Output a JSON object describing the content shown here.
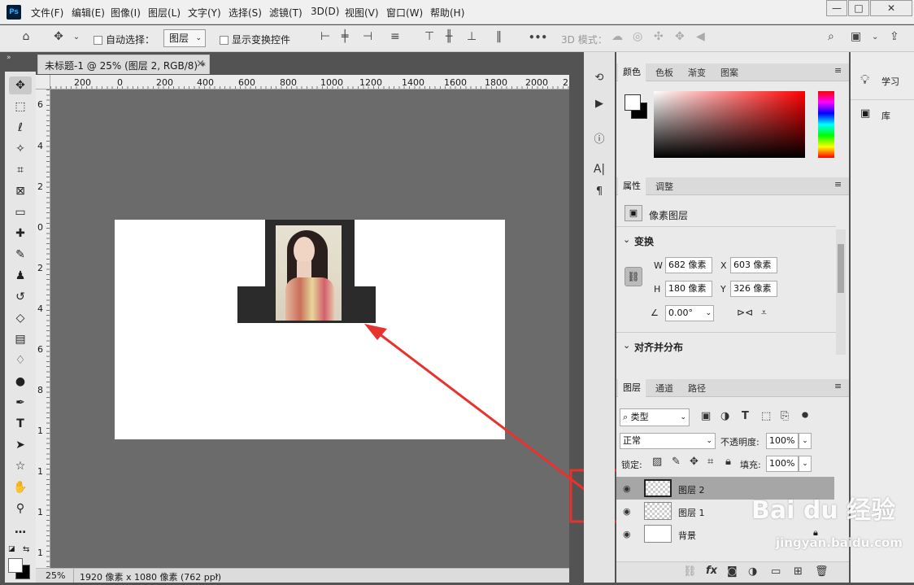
{
  "app": {
    "logo": "Ps",
    "menus": [
      "文件(F)",
      "编辑(E)",
      "图像(I)",
      "图层(L)",
      "文字(Y)",
      "选择(S)",
      "滤镜(T)",
      "3D(D)",
      "视图(V)",
      "窗口(W)",
      "帮助(H)"
    ],
    "window_buttons": {
      "minimize": "—",
      "maximize": "□",
      "close": "✕"
    }
  },
  "options": {
    "auto_select_label": "自动选择：",
    "auto_select_target": "图层",
    "show_transform_label": "显示变换控件",
    "more_label": "•••",
    "mode_3d_label": "3D 模式："
  },
  "document": {
    "tab_title": "未标题-1 @ 25% (图层 2, RGB/8) *",
    "tab_close": "×",
    "zoom": "25%",
    "size_info": "1920 像素 x 1080 像素 (762 ppi)",
    "status_arrow": "›"
  },
  "rulers": {
    "h_ticks": [
      "200",
      "0",
      "200",
      "400",
      "600",
      "800",
      "1000",
      "1200",
      "1400",
      "1600",
      "1800",
      "2000",
      "2"
    ],
    "v_ticks": [
      "6",
      "4",
      "2",
      "0",
      "2",
      "4",
      "6",
      "8",
      "1",
      "1",
      "1",
      "1"
    ]
  },
  "color_panel": {
    "tabs": [
      "颜色",
      "色板",
      "渐变",
      "图案"
    ],
    "active_tab": "颜色",
    "foreground": "#ffffff",
    "background": "#000000"
  },
  "properties_panel": {
    "tabs": [
      "属性",
      "调整"
    ],
    "active_tab": "属性",
    "layer_type": "像素图层",
    "transform_header": "变换",
    "w_label": "W",
    "w_value": "682 像素",
    "x_label": "X",
    "x_value": "603 像素",
    "h_label": "H",
    "h_value": "180 像素",
    "y_label": "Y",
    "y_value": "326 像素",
    "angle_value": "0.00°",
    "align_header": "对齐并分布"
  },
  "layers_panel": {
    "tabs": [
      "图层",
      "通道",
      "路径"
    ],
    "active_tab": "图层",
    "filter_kind": "类型",
    "blend_mode": "正常",
    "opacity_label": "不透明度:",
    "opacity_value": "100%",
    "lock_label": "锁定:",
    "fill_label": "填充:",
    "fill_value": "100%",
    "layers": [
      {
        "name": "图层 2",
        "selected": true
      },
      {
        "name": "图层 1",
        "selected": false
      },
      {
        "name": "背景",
        "selected": false
      }
    ],
    "bottom_fx": "fx"
  },
  "learn_panel": {
    "learn_label": "学习",
    "library_label": "库"
  },
  "watermark": {
    "brand": "Bai du 经验",
    "url": "jingyan.baidu.com"
  },
  "colors": {
    "annotation_red": "#e8322d",
    "selected_layer": "#a6a6a6"
  }
}
